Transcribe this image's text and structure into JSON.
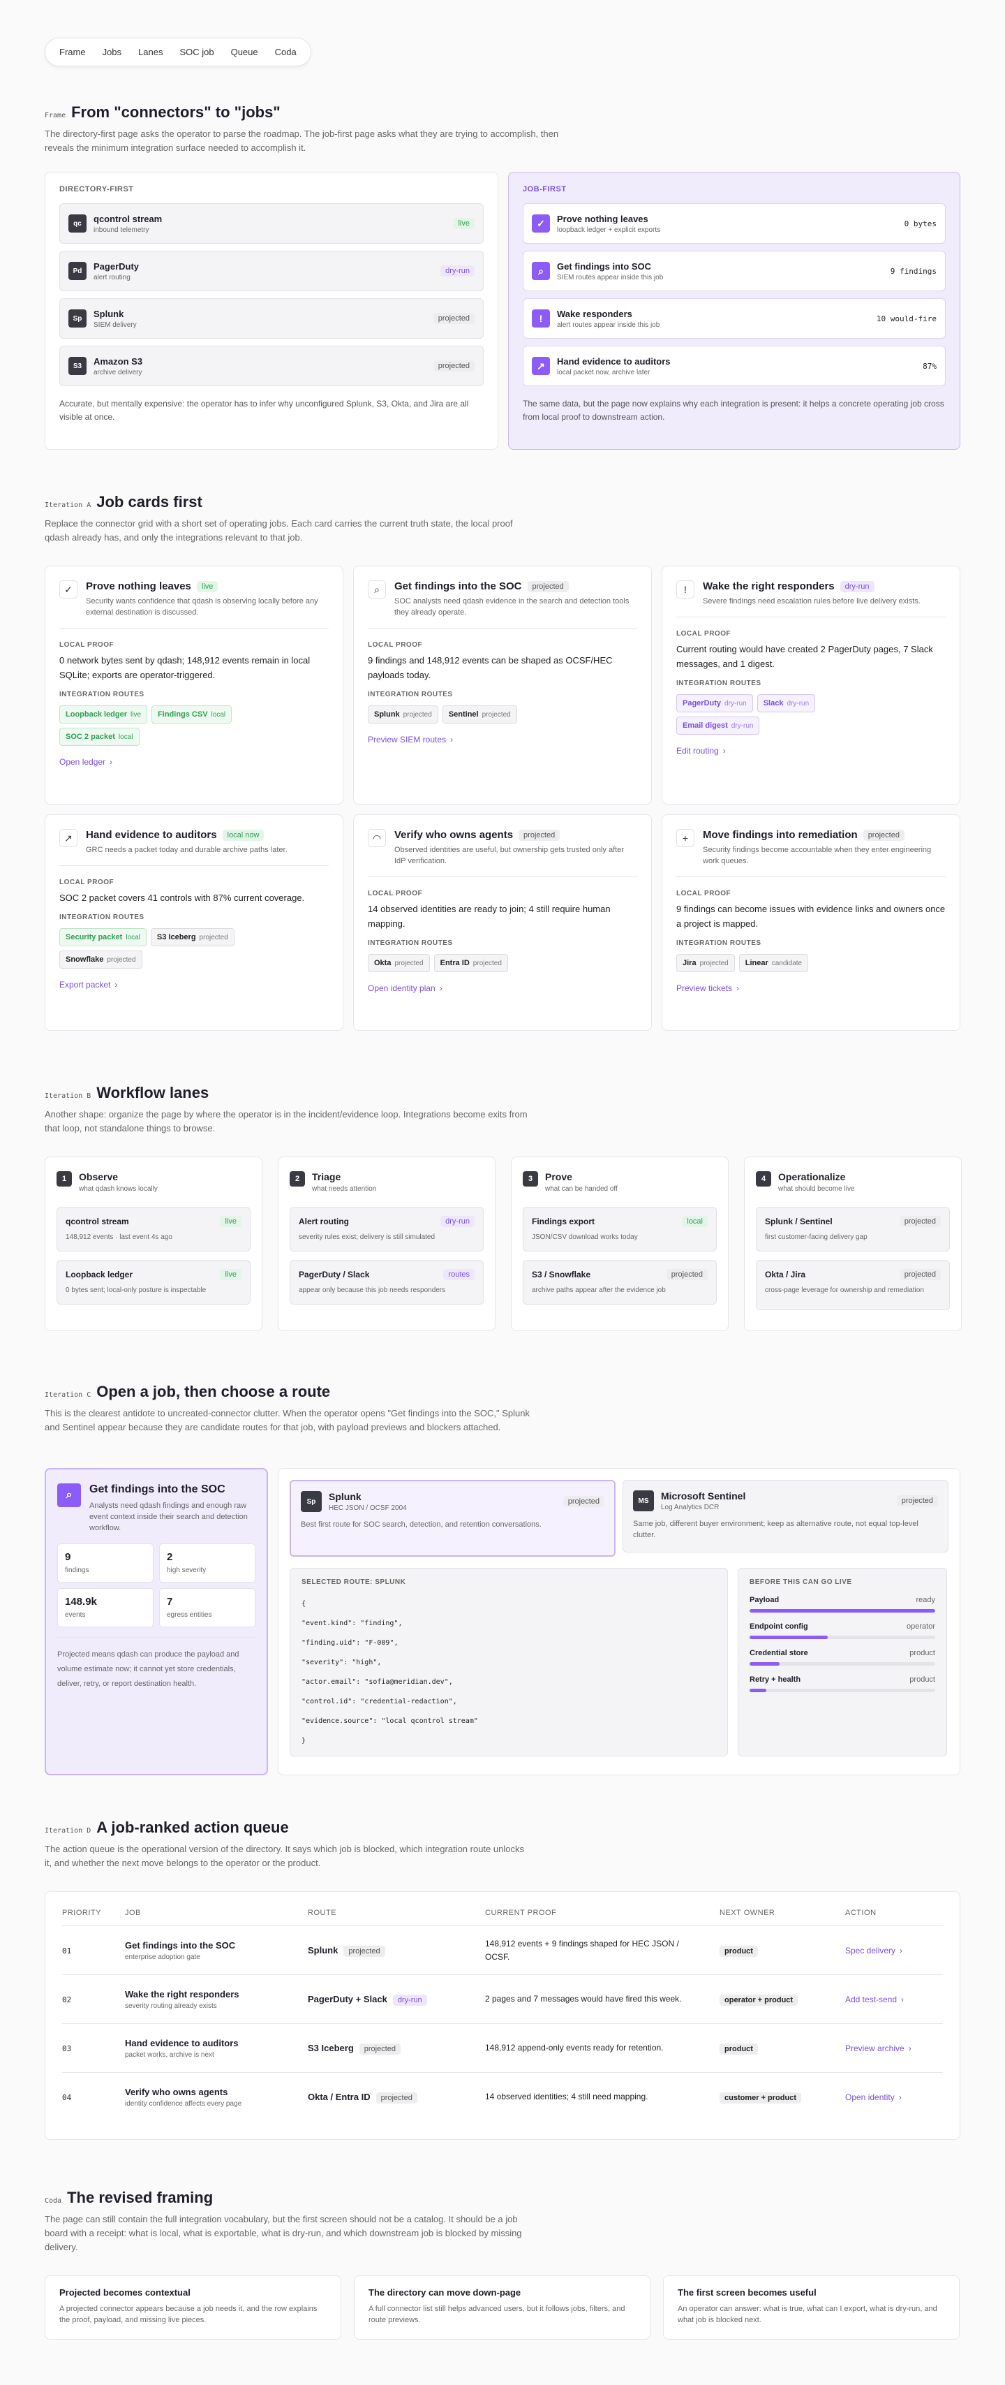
{
  "nav": [
    "Frame",
    "Jobs",
    "Lanes",
    "SOC job",
    "Queue",
    "Coda"
  ],
  "frame": {
    "tag": "Frame",
    "title": "From \"connectors\" to \"jobs\"",
    "desc": "The directory-first page asks the operator to parse the roadmap. The job-first page asks what they are trying to accomplish, then reveals the minimum integration surface needed to accomplish it.",
    "left": {
      "label": "DIRECTORY-FIRST",
      "items": [
        {
          "icon": "qc",
          "title": "qcontrol stream",
          "sub": "inbound telemetry",
          "badge": "live"
        },
        {
          "icon": "Pd",
          "title": "PagerDuty",
          "sub": "alert routing",
          "badge": "dry-run"
        },
        {
          "icon": "Sp",
          "title": "Splunk",
          "sub": "SIEM delivery",
          "badge": "projected"
        },
        {
          "icon": "S3",
          "title": "Amazon S3",
          "sub": "archive delivery",
          "badge": "projected"
        }
      ],
      "note": "Accurate, but mentally expensive: the operator has to infer why unconfigured Splunk, S3, Okta, and Jira are all visible at once."
    },
    "right": {
      "label": "JOB-FIRST",
      "items": [
        {
          "icon": "✓",
          "title": "Prove nothing leaves",
          "sub": "loopback ledger + explicit exports",
          "value": "0 bytes"
        },
        {
          "icon": "⌕",
          "title": "Get findings into SOC",
          "sub": "SIEM routes appear inside this job",
          "value": "9 findings"
        },
        {
          "icon": "!",
          "title": "Wake responders",
          "sub": "alert routes appear inside this job",
          "value": "10 would-fire"
        },
        {
          "icon": "↗",
          "title": "Hand evidence to auditors",
          "sub": "local packet now, archive later",
          "value": "87%"
        }
      ],
      "note": "The same data, but the page now explains why each integration is present: it helps a concrete operating job cross from local proof to downstream action."
    }
  },
  "iterA": {
    "tag": "Iteration A",
    "title": "Job cards first",
    "desc": "Replace the connector grid with a short set of operating jobs. Each card carries the current truth state, the local proof qdash already has, and only the integrations relevant to that job.",
    "proof_label": "LOCAL PROOF",
    "routes_label": "INTEGRATION ROUTES",
    "cards": [
      {
        "icon": "✓",
        "title": "Prove nothing leaves",
        "badge": "live",
        "desc": "Security wants confidence that qdash is observing locally before any external destination is discussed.",
        "proof": "0 network bytes sent by qdash; 148,912 events remain in local SQLite; exports are operator-triggered.",
        "chips": [
          {
            "n": "Loopback ledger",
            "s": "live"
          },
          {
            "n": "Findings CSV",
            "s": "local"
          },
          {
            "n": "SOC 2 packet",
            "s": "local"
          }
        ],
        "link": "Open ledger"
      },
      {
        "icon": "⌕",
        "title": "Get findings into the SOC",
        "badge": "projected",
        "desc": "SOC analysts need qdash evidence in the search and detection tools they already operate.",
        "proof": "9 findings and 148,912 events can be shaped as OCSF/HEC payloads today.",
        "chips": [
          {
            "n": "Splunk",
            "s": "projected"
          },
          {
            "n": "Sentinel",
            "s": "projected"
          }
        ],
        "link": "Preview SIEM routes"
      },
      {
        "icon": "!",
        "title": "Wake the right responders",
        "badge": "dry-run",
        "desc": "Severe findings need escalation rules before live delivery exists.",
        "proof": "Current routing would have created 2 PagerDuty pages, 7 Slack messages, and 1 digest.",
        "chips": [
          {
            "n": "PagerDuty",
            "s": "dry-run"
          },
          {
            "n": "Slack",
            "s": "dry-run"
          },
          {
            "n": "Email digest",
            "s": "dry-run"
          }
        ],
        "link": "Edit routing"
      },
      {
        "icon": "↗",
        "title": "Hand evidence to auditors",
        "badge": "local now",
        "desc": "GRC needs a packet today and durable archive paths later.",
        "proof": "SOC 2 packet covers 41 controls with 87% current coverage.",
        "chips": [
          {
            "n": "Security packet",
            "s": "local"
          },
          {
            "n": "S3 Iceberg",
            "s": "projected"
          },
          {
            "n": "Snowflake",
            "s": "projected"
          }
        ],
        "link": "Export packet"
      },
      {
        "icon": "◠",
        "title": "Verify who owns agents",
        "badge": "projected",
        "desc": "Observed identities are useful, but ownership gets trusted only after IdP verification.",
        "proof": "14 observed identities are ready to join; 4 still require human mapping.",
        "chips": [
          {
            "n": "Okta",
            "s": "projected"
          },
          {
            "n": "Entra ID",
            "s": "projected"
          }
        ],
        "link": "Open identity plan"
      },
      {
        "icon": "+",
        "title": "Move findings into remediation",
        "badge": "projected",
        "desc": "Security findings become accountable when they enter engineering work queues.",
        "proof": "9 findings can become issues with evidence links and owners once a project is mapped.",
        "chips": [
          {
            "n": "Jira",
            "s": "projected"
          },
          {
            "n": "Linear",
            "s": "candidate"
          }
        ],
        "link": "Preview tickets"
      }
    ]
  },
  "iterB": {
    "tag": "Iteration B",
    "title": "Workflow lanes",
    "desc": "Another shape: organize the page by where the operator is in the incident/evidence loop. Integrations become exits from that loop, not standalone things to browse.",
    "lanes": [
      {
        "num": "1",
        "title": "Observe",
        "sub": "what qdash knows locally",
        "items": [
          {
            "t": "qcontrol stream",
            "b": "live",
            "s": "148,912 events · last event 4s ago"
          },
          {
            "t": "Loopback ledger",
            "b": "live",
            "s": "0 bytes sent; local-only posture is inspectable"
          }
        ]
      },
      {
        "num": "2",
        "title": "Triage",
        "sub": "what needs attention",
        "items": [
          {
            "t": "Alert routing",
            "b": "dry-run",
            "s": "severity rules exist; delivery is still simulated"
          },
          {
            "t": "PagerDuty / Slack",
            "b": "routes",
            "s": "appear only because this job needs responders"
          }
        ]
      },
      {
        "num": "3",
        "title": "Prove",
        "sub": "what can be handed off",
        "items": [
          {
            "t": "Findings export",
            "b": "local",
            "s": "JSON/CSV download works today"
          },
          {
            "t": "S3 / Snowflake",
            "b": "projected",
            "s": "archive paths appear after the evidence job"
          }
        ]
      },
      {
        "num": "4",
        "title": "Operationalize",
        "sub": "what should become live",
        "items": [
          {
            "t": "Splunk / Sentinel",
            "b": "projected",
            "s": "first customer-facing delivery gap"
          },
          {
            "t": "Okta / Jira",
            "b": "projected",
            "s": "cross-page leverage for ownership and remediation"
          }
        ]
      }
    ]
  },
  "iterC": {
    "tag": "Iteration C",
    "title": "Open a job, then choose a route",
    "desc": "This is the clearest antidote to uncreated-connector clutter. When the operator opens \"Get findings into the SOC,\" Splunk and Sentinel appear because they are candidate routes for that job, with payload previews and blockers attached.",
    "job": {
      "title": "Get findings into the SOC",
      "desc": "Analysts need qdash findings and enough raw event context inside their search and detection workflow.",
      "stats": [
        {
          "v": "9",
          "l": "findings"
        },
        {
          "v": "2",
          "l": "high severity"
        },
        {
          "v": "148.9k",
          "l": "events"
        },
        {
          "v": "7",
          "l": "egress entities"
        }
      ],
      "note": "Projected means qdash can produce the payload and volume estimate now; it cannot yet store credentials, deliver, retry, or report destination health."
    },
    "routes": [
      {
        "icon": "Sp",
        "title": "Splunk",
        "sub": "HEC JSON / OCSF 2004",
        "badge": "projected",
        "desc": "Best first route for SOC search, detection, and retention conversations."
      },
      {
        "icon": "MS",
        "title": "Microsoft Sentinel",
        "sub": "Log Analytics DCR",
        "badge": "projected",
        "desc": "Same job, different buyer environment; keep as alternative route, not equal top-level clutter."
      }
    ],
    "payload_label": "SELECTED ROUTE: SPLUNK",
    "payload": [
      "{",
      "\"event.kind\": \"finding\",",
      "\"finding.uid\": \"F-009\",",
      "\"severity\": \"high\",",
      "\"actor.email\": \"sofia@meridian.dev\",",
      "\"control.id\": \"credential-redaction\",",
      "\"evidence.source\": \"local qcontrol stream\"",
      "}"
    ],
    "live_label": "BEFORE THIS CAN GO LIVE",
    "reqs": [
      {
        "n": "Payload",
        "s": "ready",
        "p": 1.0
      },
      {
        "n": "Endpoint config",
        "s": "operator",
        "p": 0.42
      },
      {
        "n": "Credential store",
        "s": "product",
        "p": 0.16
      },
      {
        "n": "Retry + health",
        "s": "product",
        "p": 0.09
      }
    ]
  },
  "iterD": {
    "tag": "Iteration D",
    "title": "A job-ranked action queue",
    "desc": "The action queue is the operational version of the directory. It says which job is blocked, which integration route unlocks it, and whether the next move belongs to the operator or the product.",
    "headers": [
      "PRIORITY",
      "JOB",
      "ROUTE",
      "CURRENT PROOF",
      "NEXT OWNER",
      "ACTION"
    ],
    "rows": [
      {
        "p": "01",
        "job": "Get findings into the SOC",
        "sub": "enterprise adoption gate",
        "route": "Splunk",
        "rb": "projected",
        "proof": "148,912 events + 9 findings shaped for HEC JSON / OCSF.",
        "owner": "product",
        "action": "Spec delivery"
      },
      {
        "p": "02",
        "job": "Wake the right responders",
        "sub": "severity routing already exists",
        "route": "PagerDuty + Slack",
        "rb": "dry-run",
        "proof": "2 pages and 7 messages would have fired this week.",
        "owner": "operator + product",
        "action": "Add test-send"
      },
      {
        "p": "03",
        "job": "Hand evidence to auditors",
        "sub": "packet works, archive is next",
        "route": "S3 Iceberg",
        "rb": "projected",
        "proof": "148,912 append-only events ready for retention.",
        "owner": "product",
        "action": "Preview archive"
      },
      {
        "p": "04",
        "job": "Verify who owns agents",
        "sub": "identity confidence affects every page",
        "route": "Okta / Entra ID",
        "rb": "projected",
        "proof": "14 observed identities; 4 still need mapping.",
        "owner": "customer + product",
        "action": "Open identity"
      }
    ]
  },
  "coda": {
    "tag": "Coda",
    "title": "The revised framing",
    "desc": "The page can still contain the full integration vocabulary, but the first screen should not be a catalog. It should be a job board with a receipt: what is local, what is exportable, what is dry-run, and which downstream job is blocked by missing delivery.",
    "cards": [
      {
        "t": "Projected becomes contextual",
        "d": "A projected connector appears because a job needs it, and the row explains the proof, payload, and missing live pieces."
      },
      {
        "t": "The directory can move down-page",
        "d": "A full connector list still helps advanced users, but it follows jobs, filters, and route previews."
      },
      {
        "t": "The first screen becomes useful",
        "d": "An operator can answer: what is true, what can I export, what is dry-run, and what job is blocked next."
      }
    ]
  },
  "colors": {
    "accent": "#7b4fd8",
    "live": "#2e9e51"
  }
}
